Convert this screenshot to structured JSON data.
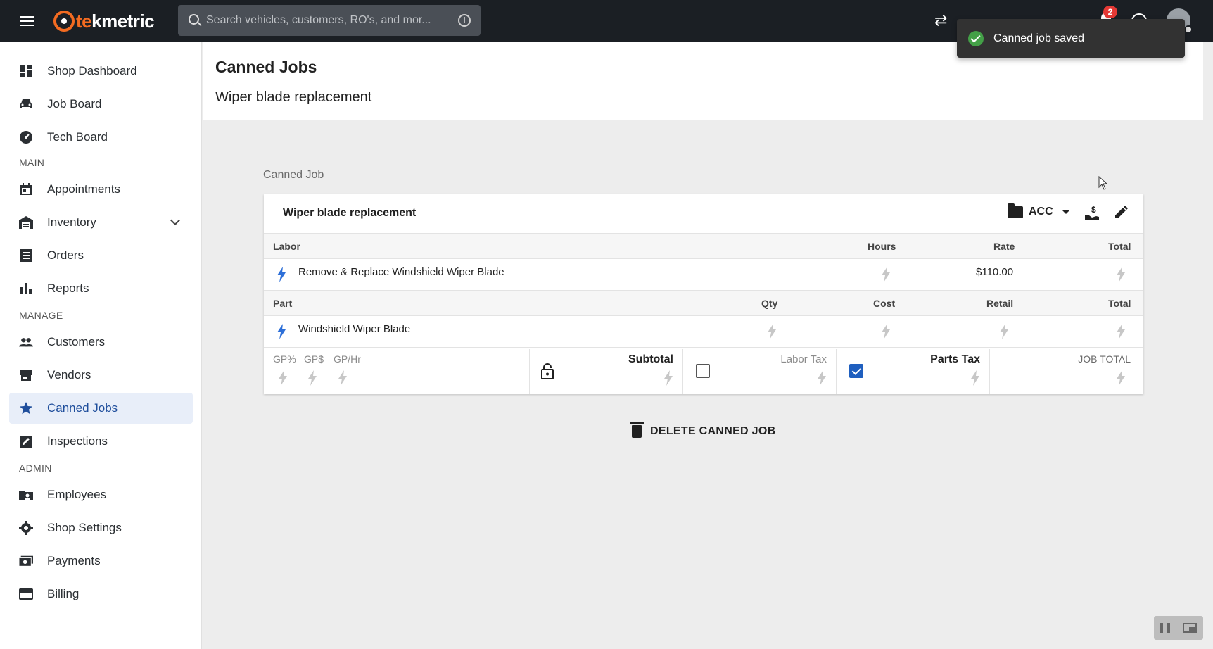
{
  "app": {
    "logo_part1": "te",
    "logo_part2": "kmetric",
    "search_placeholder": "Search vehicles, customers, RO's, and mor...",
    "notification_count": "2"
  },
  "sidebar": {
    "top_items": [
      {
        "label": "Shop Dashboard",
        "icon": "dashboard-icon"
      },
      {
        "label": "Job Board",
        "icon": "car-icon"
      },
      {
        "label": "Tech Board",
        "icon": "speedometer-icon"
      }
    ],
    "section_main": "MAIN",
    "main_items": [
      {
        "label": "Appointments",
        "icon": "calendar-icon"
      },
      {
        "label": "Inventory",
        "icon": "warehouse-icon"
      },
      {
        "label": "Orders",
        "icon": "list-icon"
      },
      {
        "label": "Reports",
        "icon": "bar-chart-icon"
      }
    ],
    "section_manage": "MANAGE",
    "manage_items": [
      {
        "label": "Customers",
        "icon": "people-icon"
      },
      {
        "label": "Vendors",
        "icon": "store-icon"
      },
      {
        "label": "Canned Jobs",
        "icon": "star-icon",
        "active": true
      },
      {
        "label": "Inspections",
        "icon": "clipboard-icon"
      }
    ],
    "section_admin": "ADMIN",
    "admin_items": [
      {
        "label": "Employees",
        "icon": "employee-folder-icon"
      },
      {
        "label": "Shop Settings",
        "icon": "gear-icon"
      },
      {
        "label": "Payments",
        "icon": "payments-icon"
      },
      {
        "label": "Billing",
        "icon": "credit-card-icon"
      }
    ]
  },
  "header": {
    "title": "Canned Jobs",
    "subtitle": "Wiper blade replacement"
  },
  "card": {
    "section_label": "Canned Job",
    "title": "Wiper blade replacement",
    "category": "ACC",
    "labor_header": {
      "col1": "Labor",
      "hours": "Hours",
      "rate": "Rate",
      "total": "Total"
    },
    "labor_rows": [
      {
        "name": "Remove & Replace Windshield Wiper Blade",
        "rate": "$110.00"
      }
    ],
    "part_header": {
      "col1": "Part",
      "qty": "Qty",
      "cost": "Cost",
      "retail": "Retail",
      "total": "Total"
    },
    "part_rows": [
      {
        "name": "Windshield Wiper Blade"
      }
    ],
    "totals": {
      "gp_pct": "GP%",
      "gp_dollar": "GP$",
      "gp_hr": "GP/Hr",
      "subtotal": "Subtotal",
      "labor_tax": "Labor Tax",
      "labor_tax_checked": false,
      "parts_tax": "Parts Tax",
      "parts_tax_checked": true,
      "job_total": "JOB TOTAL"
    },
    "delete_label": "DELETE CANNED JOB"
  },
  "toast": {
    "message": "Canned job saved",
    "status_color": "#43a047"
  },
  "colors": {
    "topbar": "#1b1f24",
    "brand_orange": "#f36b21",
    "accent_blue": "#1f5fbf",
    "active_nav_bg": "#e8eef9"
  }
}
